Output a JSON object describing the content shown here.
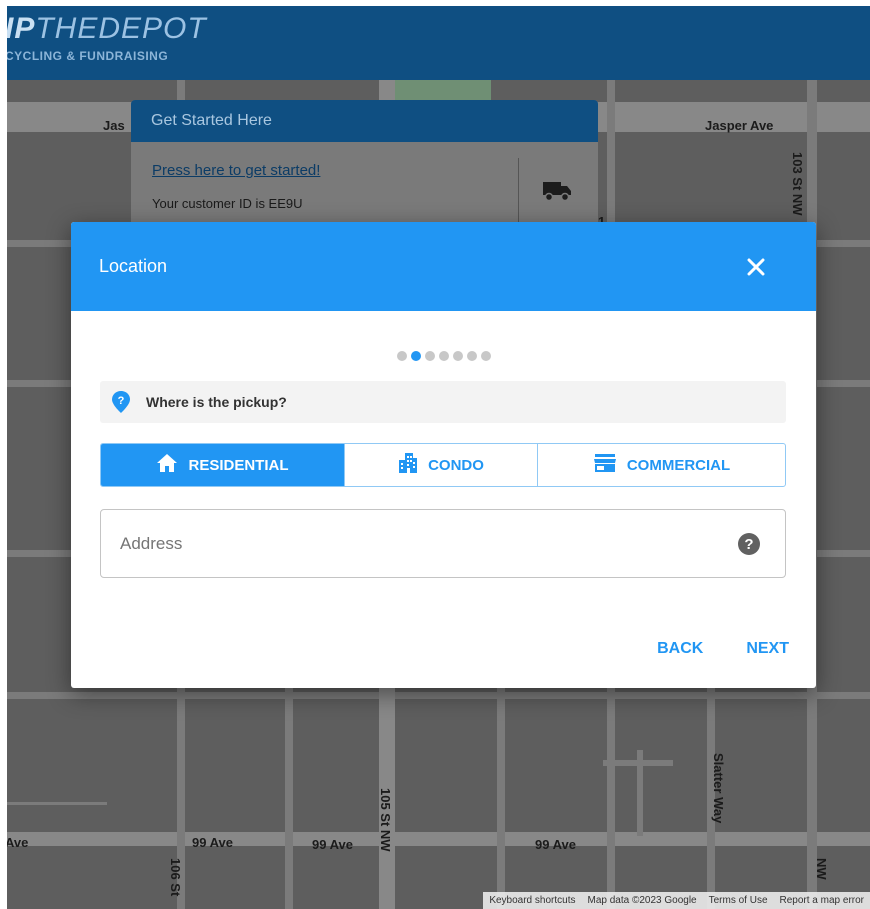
{
  "header": {
    "logo_bold": "IP",
    "logo_rest": "THEDEPOT",
    "logo_subtitle": "CYCLING & FUNDRAISING"
  },
  "map": {
    "labels": {
      "jasper_left": "Jas",
      "jasper_right": "Jasper Ave",
      "st103": "103 St NW",
      "st105": "105 St NW",
      "st106": "106 St",
      "ave99_a": "Ave",
      "ave99_b": "99 Ave",
      "ave99_c": "99 Ave",
      "ave99_d": "99 Ave",
      "slatter": "Slatter Way",
      "right_nw": "NW",
      "mid_1": "1"
    },
    "footer": [
      "Keyboard shortcuts",
      "Map data ©2023 Google",
      "Terms of Use",
      "Report a map error"
    ]
  },
  "get_started": {
    "title": "Get Started Here",
    "link": "Press here to get started!",
    "customer_id": "Your customer ID is EE9U",
    "icon": "truck-icon"
  },
  "dialog": {
    "title": "Location",
    "close_icon": "close-icon",
    "steps_total": 7,
    "steps_current": 2,
    "question": "Where is the pickup?",
    "question_icon": "location-help-icon",
    "options": [
      {
        "label": "RESIDENTIAL",
        "icon": "home-icon",
        "selected": true
      },
      {
        "label": "CONDO",
        "icon": "building-icon",
        "selected": false
      },
      {
        "label": "COMMERCIAL",
        "icon": "store-icon",
        "selected": false
      }
    ],
    "address_placeholder": "Address",
    "address_value": "",
    "help_glyph": "?",
    "back_label": "BACK",
    "next_label": "NEXT"
  },
  "colors": {
    "header_bg": "#0f4f82",
    "dialog_header": "#2196f3",
    "accent": "#2196f3"
  }
}
